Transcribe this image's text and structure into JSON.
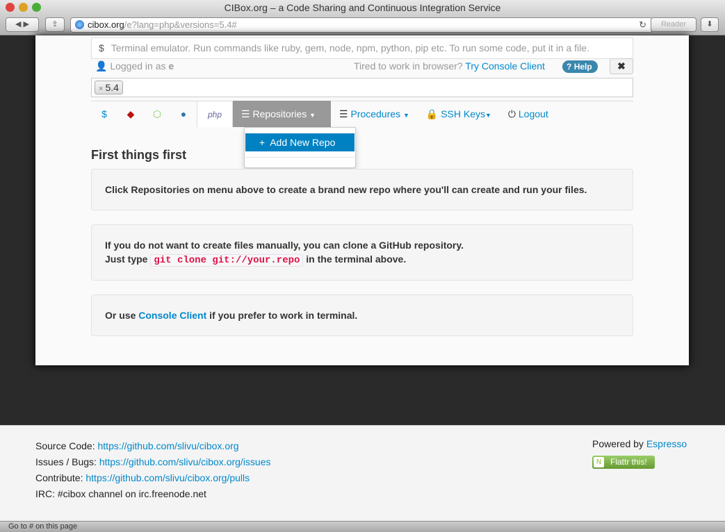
{
  "window": {
    "title": "CIBox.org – a Code Sharing and Continuous Integration Service"
  },
  "browser": {
    "url_host": "cibox.org",
    "url_path": "/e?lang=php&versions=5.4#",
    "reader": "Reader",
    "status": "Go to # on this page"
  },
  "terminal": {
    "prompt": "$",
    "placeholder": "Terminal emulator. Run commands like ruby, gem, node, npm, python, pip etc. To run some code, put it in a file."
  },
  "user": {
    "logged_in_label": "Logged in as",
    "username": "e"
  },
  "console": {
    "prompt": "Tired to work in browser?",
    "link": "Try Console Client"
  },
  "help": "Help",
  "close": "✖",
  "tags": [
    {
      "remove": "×",
      "value": "5.4"
    }
  ],
  "nav": {
    "langs": [
      {
        "name": "shell",
        "glyph": "$"
      },
      {
        "name": "ruby",
        "glyph": "◆"
      },
      {
        "name": "node",
        "glyph": "⬡"
      },
      {
        "name": "python",
        "glyph": "●"
      },
      {
        "name": "php",
        "glyph": "php"
      }
    ],
    "repositories": "Repositories",
    "procedures": "Procedures",
    "ssh_keys": "SSH Keys",
    "logout": "Logout"
  },
  "dropdown": {
    "add_new_repo": "Add New Repo"
  },
  "content": {
    "heading": "First things first",
    "box1": "Click Repositories on menu above to create a brand new repo where you'll can create and run your files.",
    "box2_line1": "If you do not want to create files manually, you can clone a GitHub repository.",
    "box2_pre": "Just type",
    "box2_code": "git clone git://your.repo",
    "box2_post": "in the terminal above.",
    "box3_pre": "Or use",
    "box3_link": "Console Client",
    "box3_post": "if you prefer to work in terminal."
  },
  "footer": {
    "source_label": "Source Code:",
    "source_url": "https://github.com/slivu/cibox.org",
    "issues_label": "Issues / Bugs:",
    "issues_url": "https://github.com/slivu/cibox.org/issues",
    "contribute_label": "Contribute:",
    "contribute_url": "https://github.com/slivu/cibox.org/pulls",
    "irc": "IRC: #cibox channel on irc.freenode.net",
    "powered_label": "Powered by",
    "powered_link": "Espresso",
    "flattr": "Flattr this!"
  }
}
